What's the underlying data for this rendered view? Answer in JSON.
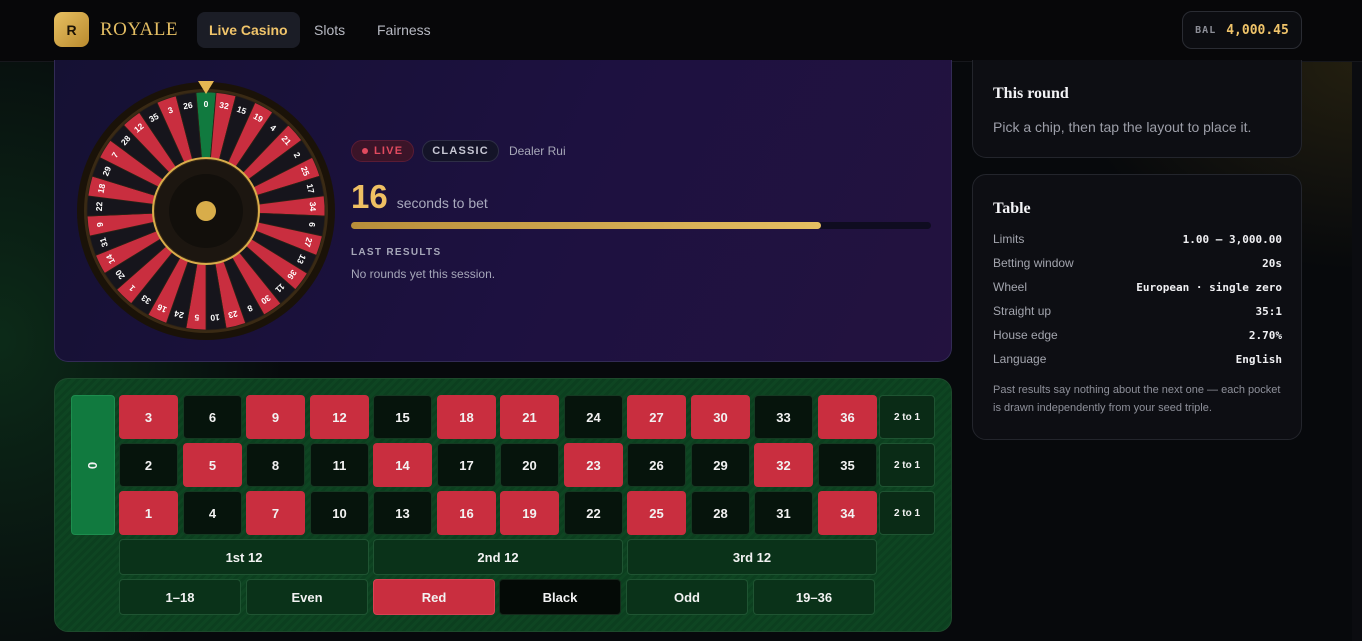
{
  "brand": {
    "logo_letter": "R",
    "name": "ROYALE"
  },
  "nav": {
    "items": [
      {
        "label": "Live Casino",
        "active": true
      },
      {
        "label": "Slots",
        "active": false
      },
      {
        "label": "Fairness",
        "active": false
      }
    ]
  },
  "balance": {
    "label": "BAL",
    "value": "4,000.45"
  },
  "wheel": {
    "numbers": [
      0,
      32,
      15,
      19,
      4,
      21,
      2,
      25,
      17,
      34,
      6,
      27,
      13,
      36,
      11,
      30,
      8,
      23,
      10,
      5,
      24,
      16,
      33,
      1,
      20,
      14,
      31,
      9,
      22,
      18,
      29,
      7,
      28,
      12,
      35,
      3,
      26
    ],
    "red_numbers": [
      1,
      3,
      5,
      7,
      9,
      12,
      14,
      16,
      18,
      19,
      21,
      23,
      25,
      27,
      30,
      32,
      34,
      36
    ],
    "colors": {
      "red": "#c92e3f",
      "black": "#16151c",
      "green": "#117a3f",
      "gold": "#d8ad4a"
    }
  },
  "round": {
    "live_label": "LIVE",
    "mode_label": "CLASSIC",
    "dealer": "Dealer Rui",
    "seconds": "16",
    "seconds_text": "seconds to bet",
    "progress_fraction": 0.81,
    "last_results_label": "LAST RESULTS",
    "last_results_empty": "No rounds yet this session."
  },
  "bet_table": {
    "zero": "0",
    "rows": [
      [
        3,
        6,
        9,
        12,
        15,
        18,
        21,
        24,
        27,
        30,
        33,
        36
      ],
      [
        2,
        5,
        8,
        11,
        14,
        17,
        20,
        23,
        26,
        29,
        32,
        35
      ],
      [
        1,
        4,
        7,
        10,
        13,
        16,
        19,
        22,
        25,
        28,
        31,
        34
      ]
    ],
    "column_bets": [
      "2 to 1",
      "2 to 1",
      "2 to 1"
    ],
    "dozens": [
      "1st 12",
      "2nd 12",
      "3rd 12"
    ],
    "outside": [
      "1–18",
      "Even",
      "Red",
      "Black",
      "Odd",
      "19–36"
    ]
  },
  "this_round": {
    "title": "This round",
    "text": "Pick a chip, then tap the layout to place it."
  },
  "table_info": {
    "title": "Table",
    "rows": [
      {
        "key": "Limits",
        "value": "1.00 – 3,000.00"
      },
      {
        "key": "Betting window",
        "value": "20s"
      },
      {
        "key": "Wheel",
        "value": "European · single zero"
      },
      {
        "key": "Straight up",
        "value": "35:1"
      },
      {
        "key": "House edge",
        "value": "2.70%"
      },
      {
        "key": "Language",
        "value": "English"
      }
    ],
    "note": "Past results say nothing about the next one — each pocket is drawn independently from your seed triple."
  }
}
